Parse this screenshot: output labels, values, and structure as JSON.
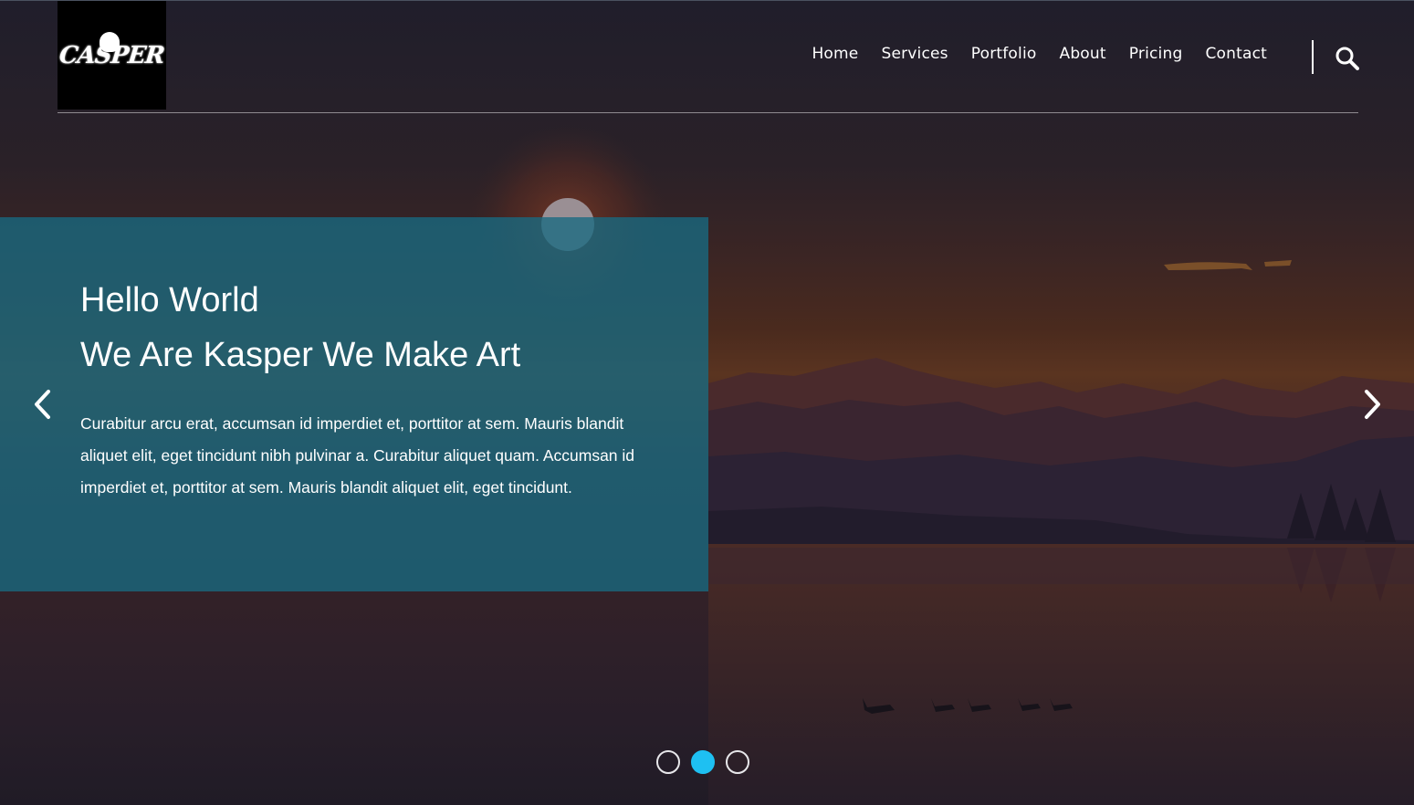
{
  "logo": {
    "text": "CASPER"
  },
  "nav": {
    "items": [
      {
        "label": "Home"
      },
      {
        "label": "Services"
      },
      {
        "label": "Portfolio"
      },
      {
        "label": "About"
      },
      {
        "label": "Pricing"
      },
      {
        "label": "Contact"
      }
    ],
    "search_icon": "search-icon"
  },
  "hero": {
    "title_line1": "Hello World",
    "title_line2": "We Are Kasper We Make Art",
    "description": "Curabitur arcu erat, accumsan id imperdiet et, porttitor at sem. Mauris blandit aliquet elit, eget tincidunt nibh pulvinar a. Curabitur aliquet quam. Accumsan id imperdiet et, porttitor at sem. Mauris blandit aliquet elit, eget tincidunt."
  },
  "carousel": {
    "prev_icon": "chevron-left-icon",
    "next_icon": "chevron-right-icon",
    "slide_count": 3,
    "active_slide": 2
  },
  "colors": {
    "panel": "#186a82",
    "accent": "#1ec0f2",
    "logo_bg": "#000000"
  }
}
